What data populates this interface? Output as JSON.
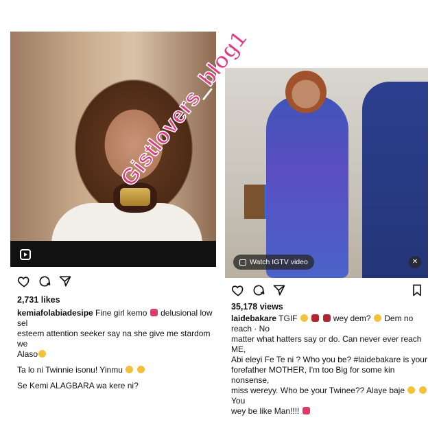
{
  "left_post": {
    "likes": "2,731 likes",
    "caption_user": "kemiafolabiadesipe",
    "caption_line1": " Fine girl kemo",
    "caption_line1b": " delusional low sel",
    "caption_line2": "esteem attention seeker say na she give me stardom we",
    "caption_line3": "Alaso",
    "para2": "Ta lo ni Twinnie isonu! Yinmu",
    "para3": "Se Kemi ALAGBARA wa kere ni?",
    "icons": [
      "heart-icon",
      "comment-icon",
      "share-icon",
      "reels-icon"
    ]
  },
  "right_post": {
    "views": "35,178 views",
    "caption_user": "laidebakare",
    "caption_a": " TGIF ",
    "caption_b": " wey dem?",
    "caption_c": " Dem no reach · No",
    "caption_line2": "matter what hatters say or do. Can never ever reach ME,",
    "caption_line3": "Abi eleyi Fe Te ni ? Who you be? #laidebakare is your",
    "caption_line4": "forefather MOTHER, I'm too Big for some kin nonsense,",
    "caption_line5": "miss wereyy. Who be your Twinee?? Alaye baje ",
    "caption_line5b": " You",
    "caption_line6": "wey be like Man!!!!",
    "igtv_label": "Watch IGTV video",
    "icons": [
      "heart-icon",
      "comment-icon",
      "share-icon",
      "bookmark-icon",
      "mute-icon"
    ]
  },
  "watermark": "Gistlovers_blog1"
}
